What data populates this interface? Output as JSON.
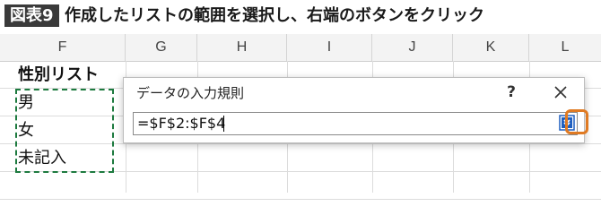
{
  "caption": {
    "label": "図表9",
    "text": "作成したリストの範囲を選択し、右端のボタンをクリック"
  },
  "sheet": {
    "columns": [
      "F",
      "G",
      "H",
      "I",
      "J",
      "K",
      "L"
    ],
    "cells": {
      "F1": "性別リスト",
      "F2": "男",
      "F3": "女",
      "F4": "未記入"
    }
  },
  "dialog": {
    "title": "データの入力規則",
    "help_label": "?",
    "range_value": "=$F$2:$F$4"
  },
  "colors": {
    "marching_ants": "#1d7a3f",
    "highlight": "#e07a22",
    "expand_button": "#1f5fbf"
  }
}
